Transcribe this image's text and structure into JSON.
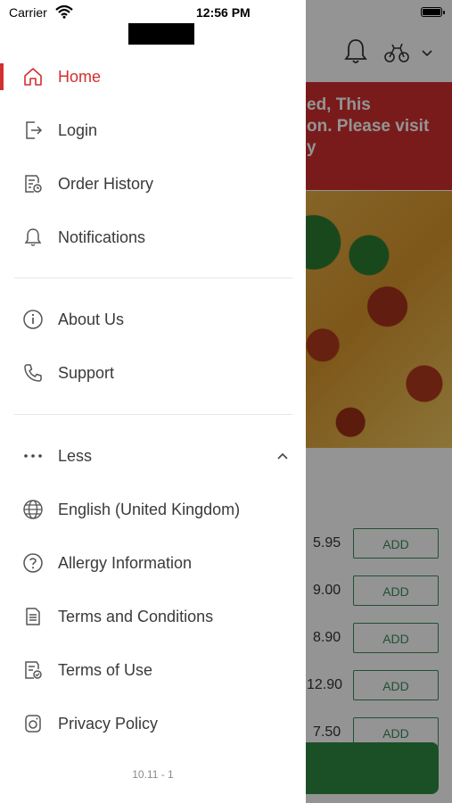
{
  "status_bar": {
    "carrier": "Carrier",
    "time": "12:56 PM"
  },
  "background": {
    "banner_lines": [
      "ed, This",
      "on. Please visit",
      "y"
    ],
    "prices": [
      "5.95",
      "9.00",
      "8.90",
      "12.90",
      "7.50"
    ],
    "add_label": "ADD"
  },
  "menu": {
    "home": "Home",
    "login": "Login",
    "order_history": "Order History",
    "notifications": "Notifications",
    "about_us": "About Us",
    "support": "Support",
    "less": "Less",
    "language": "English (United Kingdom)",
    "allergy": "Allergy Information",
    "terms_conditions": "Terms and Conditions",
    "terms_use": "Terms of Use",
    "privacy": "Privacy Policy"
  },
  "version": "10.11 - 1",
  "colors": {
    "accent": "#d32f2f",
    "green": "#2f8a43"
  }
}
